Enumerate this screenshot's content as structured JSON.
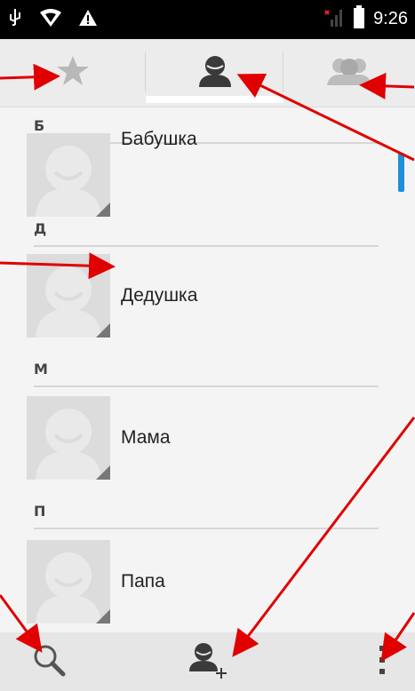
{
  "status_bar": {
    "time": "9:26",
    "icons": [
      "usb-icon",
      "wifi-icon",
      "warning-icon",
      "signal-icon",
      "battery-icon"
    ]
  },
  "tabs": [
    {
      "name": "favorites",
      "icon": "star-icon"
    },
    {
      "name": "contacts",
      "icon": "person-icon",
      "selected": true
    },
    {
      "name": "groups",
      "icon": "group-icon"
    }
  ],
  "contacts": {
    "sections": [
      {
        "letter": "Б",
        "names": [
          "Бабушка"
        ]
      },
      {
        "letter": "Д",
        "names": [
          "Дедушка"
        ]
      },
      {
        "letter": "М",
        "names": [
          "Мама"
        ]
      },
      {
        "letter": "П",
        "names": [
          "Папа"
        ]
      }
    ]
  },
  "bottom_bar": {
    "buttons": [
      "search-icon",
      "add-contact-icon",
      "overflow-menu-icon"
    ]
  },
  "colors": {
    "accent": "#1e8fd8",
    "annotation_arrow": "#e00000"
  }
}
